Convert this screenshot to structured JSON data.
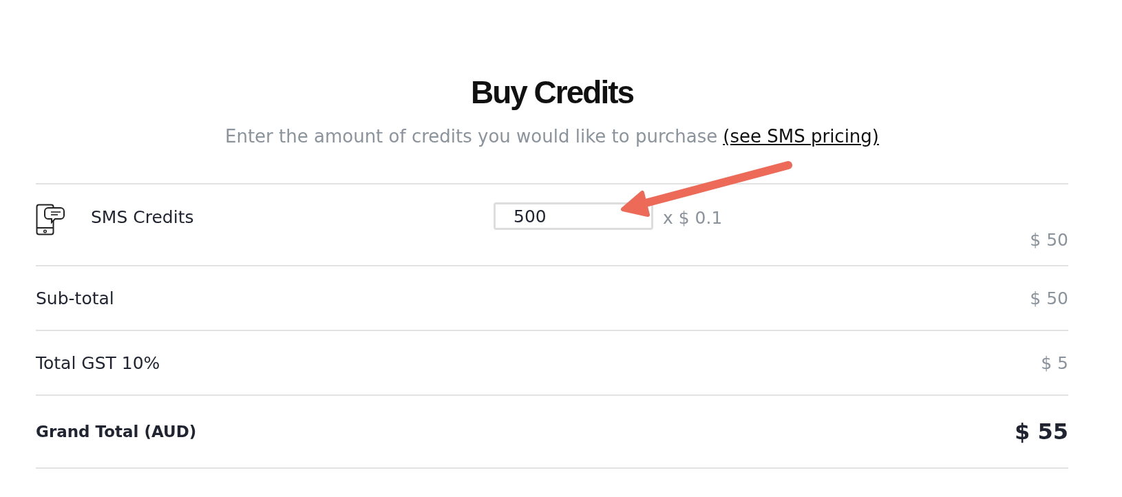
{
  "title": "Buy Credits",
  "subtitle": {
    "text": "Enter the amount of credits you would like to purchase",
    "link": "(see SMS pricing)"
  },
  "item": {
    "label": "SMS Credits",
    "quantity": "500",
    "unit_price": "x $ 0.1",
    "amount": "$ 50"
  },
  "summary": [
    {
      "label": "Sub-total",
      "value": "$ 50",
      "kind": "normal"
    },
    {
      "label": "Total GST 10%",
      "value": "$ 5",
      "kind": "normal"
    },
    {
      "label": "Grand Total (AUD)",
      "value": "$ 55",
      "kind": "total"
    }
  ]
}
